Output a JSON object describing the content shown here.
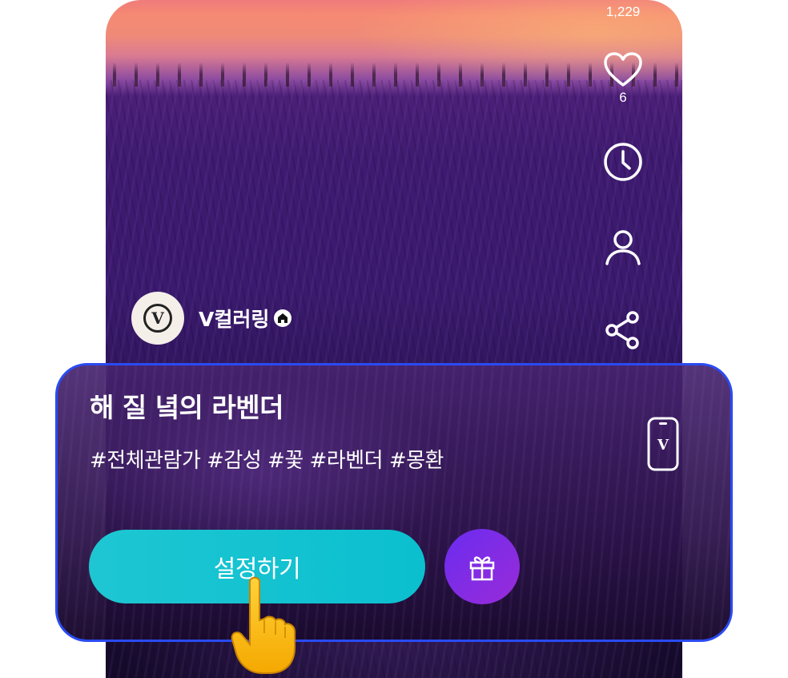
{
  "stats": {
    "view_count": "1,229",
    "like_count": "6"
  },
  "rail": {
    "icons": [
      "heart-icon",
      "clock-icon",
      "person-icon",
      "share-icon"
    ]
  },
  "channel": {
    "name": "V컬러링",
    "avatar_letter": "V"
  },
  "card": {
    "title": "해 질 녘의 라벤더",
    "tags": "#전체관람가 #감성 #꽃 #라벤더 #몽환",
    "primary_button": "설정하기",
    "phone_icon_letter": "V"
  },
  "colors": {
    "card_border": "#2a4bf2",
    "primary_button": "#0bbfcf",
    "gift_button": "#7a2ce8"
  }
}
